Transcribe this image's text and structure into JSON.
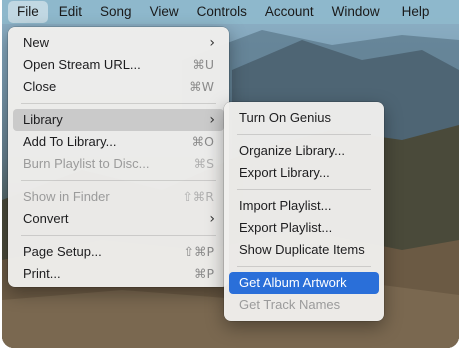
{
  "menubar": {
    "items": [
      "File",
      "Edit",
      "Song",
      "View",
      "Controls",
      "Account",
      "Window",
      "Help"
    ]
  },
  "file_menu": {
    "new": {
      "label": "New",
      "has_submenu": true
    },
    "open_stream": {
      "label": "Open Stream URL...",
      "shortcut": "⌘U"
    },
    "close": {
      "label": "Close",
      "shortcut": "⌘W"
    },
    "library": {
      "label": "Library",
      "has_submenu": true
    },
    "add_to_library": {
      "label": "Add To Library...",
      "shortcut": "⌘O"
    },
    "burn_playlist": {
      "label": "Burn Playlist to Disc...",
      "shortcut": "⌘S"
    },
    "show_in_finder": {
      "label": "Show in Finder",
      "shortcut": "⇧⌘R"
    },
    "convert": {
      "label": "Convert",
      "has_submenu": true
    },
    "page_setup": {
      "label": "Page Setup...",
      "shortcut": "⇧⌘P"
    },
    "print": {
      "label": "Print...",
      "shortcut": "⌘P"
    }
  },
  "library_menu": {
    "turn_on_genius": "Turn On Genius",
    "organize_library": "Organize Library...",
    "export_library": "Export Library...",
    "import_playlist": "Import Playlist...",
    "export_playlist": "Export Playlist...",
    "show_duplicates": "Show Duplicate Items",
    "get_album_artwork": "Get Album Artwork",
    "get_track_names": "Get Track Names"
  },
  "colors": {
    "highlight": "#2a6fd9",
    "menubar": "#8eb8cc"
  }
}
